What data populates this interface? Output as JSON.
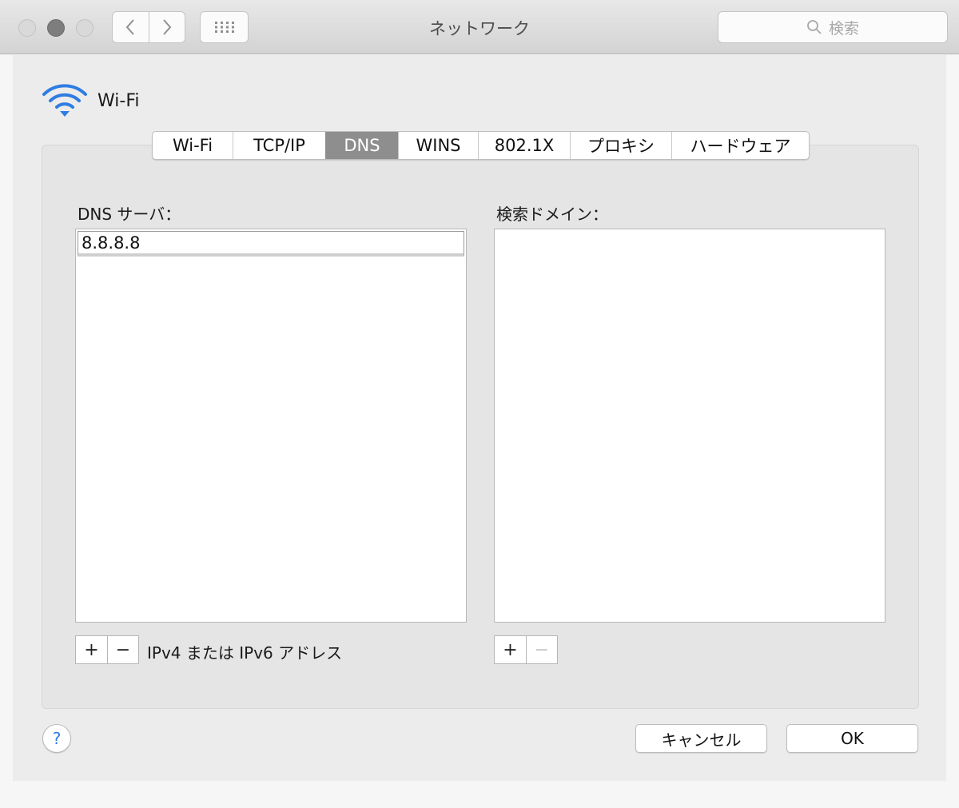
{
  "window": {
    "title": "ネットワーク"
  },
  "search": {
    "placeholder": "検索"
  },
  "interface": {
    "name": "Wi-Fi"
  },
  "tabs": [
    {
      "label": "Wi-Fi",
      "active": false
    },
    {
      "label": "TCP/IP",
      "active": false
    },
    {
      "label": "DNS",
      "active": true
    },
    {
      "label": "WINS",
      "active": false
    },
    {
      "label": "802.1X",
      "active": false
    },
    {
      "label": "プロキシ",
      "active": false
    },
    {
      "label": "ハードウェア",
      "active": false
    }
  ],
  "dns": {
    "label": "DNS サーバ：",
    "entries": [
      "8.8.8.8"
    ],
    "hint": "IPv4 または IPv6 アドレス",
    "add_symbol": "+",
    "remove_symbol": "−"
  },
  "search_domains": {
    "label": "検索ドメイン：",
    "entries": [],
    "add_symbol": "+",
    "remove_symbol": "−"
  },
  "footer": {
    "help_symbol": "?",
    "cancel_label": "キャンセル",
    "ok_label": "OK"
  },
  "icons": {
    "wifi": "wifi-icon",
    "search": "magnifier-icon",
    "back": "chevron-left-icon",
    "forward": "chevron-right-icon",
    "grid": "grid-icon"
  },
  "colors": {
    "accent": "#2f7de1",
    "tab_active_bg": "#8e8e8e"
  }
}
